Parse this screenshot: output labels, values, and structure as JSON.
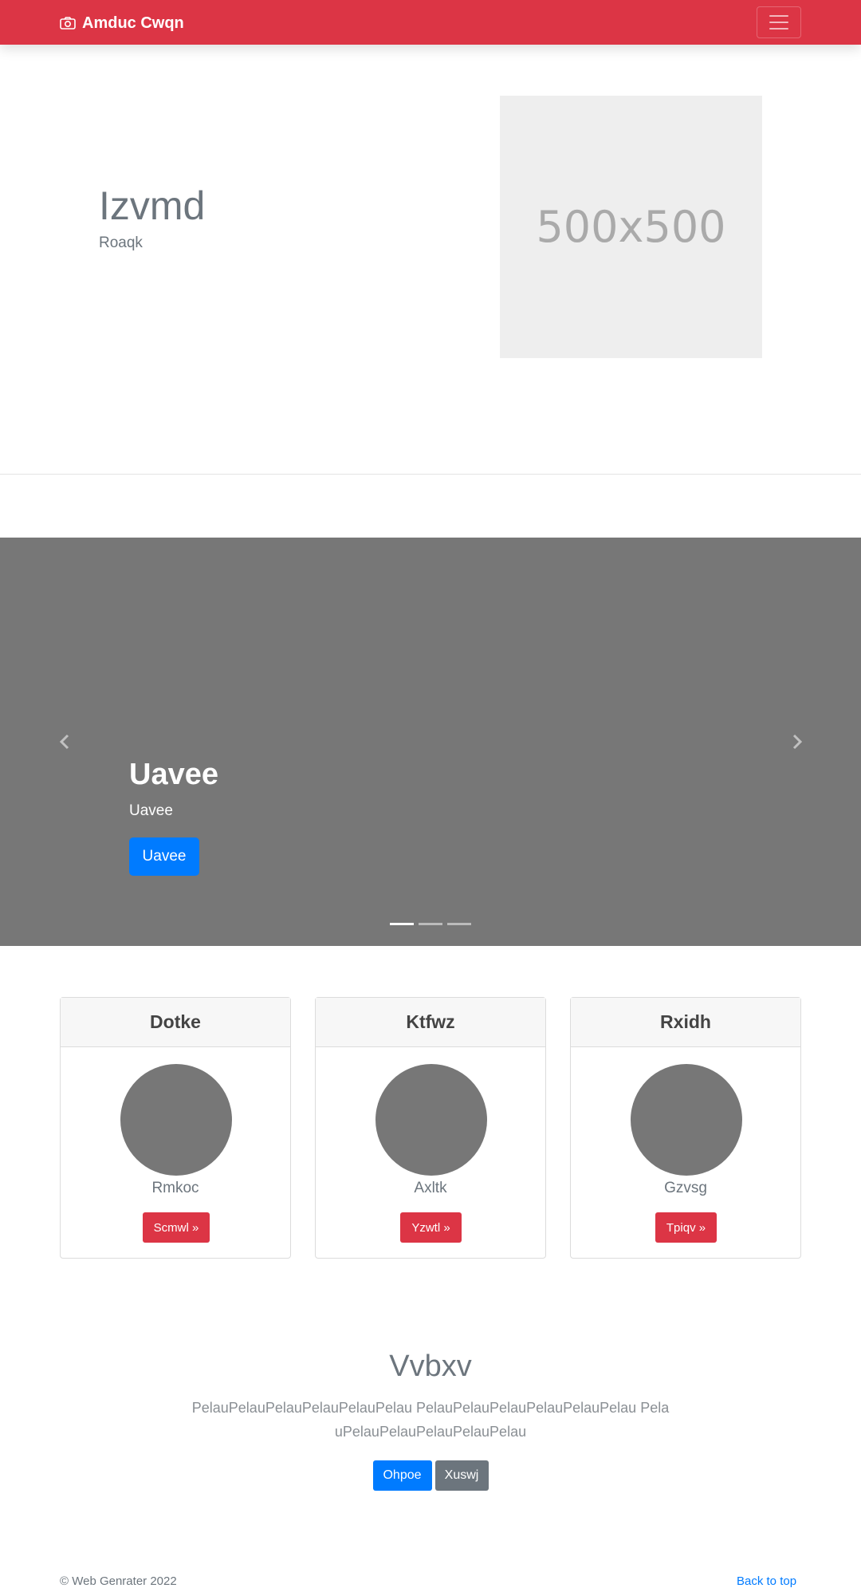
{
  "navbar": {
    "brand": "Amduc Cwqn",
    "brand_icon": "camera-icon",
    "toggler_icon": "hamburger-icon",
    "color": "#dc3545"
  },
  "hero": {
    "title": "Izvmd",
    "subtitle": "Roaqk",
    "placeholder_text": "500x500"
  },
  "carousel": {
    "title": "Uavee",
    "text": "Uavee",
    "button": "Uavee",
    "prev_icon": "chevron-left-icon",
    "next_icon": "chevron-right-icon",
    "slide_count": 3,
    "active_slide": 1
  },
  "cards": [
    {
      "header": "Dotke",
      "name": "Rmkoc",
      "button": "Scmwl »"
    },
    {
      "header": "Ktfwz",
      "name": "Axltk",
      "button": "Yzwtl »"
    },
    {
      "header": "Rxidh",
      "name": "Gzvsg",
      "button": "Tpiqv »"
    }
  ],
  "cta": {
    "title": "Vvbxv",
    "text": "PelauPelauPelauPelauPelauPelau PelauPelauPelauPelauPelauPelau PelauPelauPelauPelauPelauPelau",
    "primary_button": "Ohpoe",
    "secondary_button": "Xuswj"
  },
  "footer": {
    "copyright": "© Web Genrater 2022",
    "back_to_top": "Back to top"
  }
}
